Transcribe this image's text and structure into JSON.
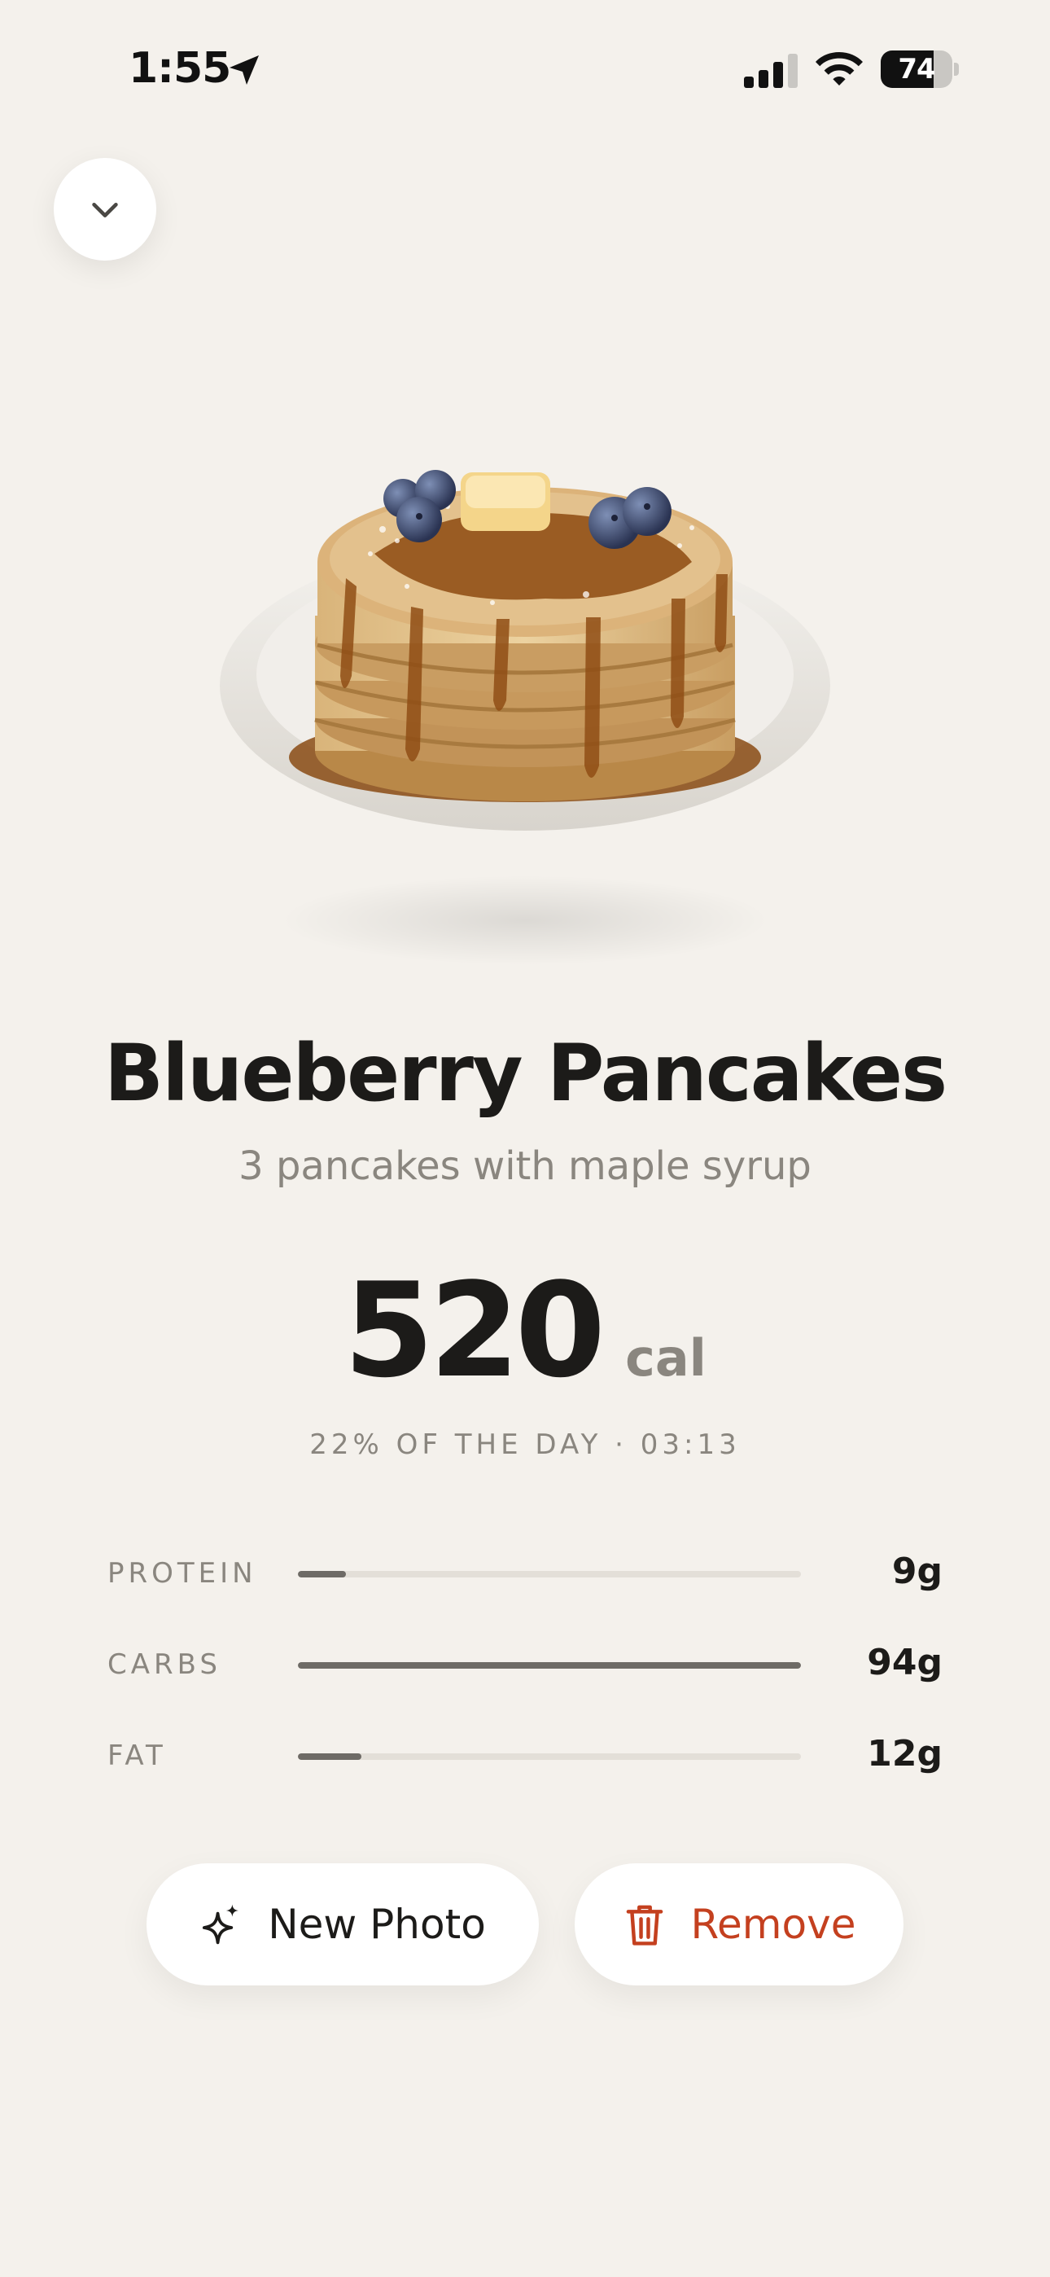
{
  "status_bar": {
    "time": "1:55",
    "battery_percent": 74,
    "battery_label": "74",
    "icons": [
      "location-arrow-icon",
      "cellular-signal-icon",
      "wifi-icon",
      "battery-icon"
    ]
  },
  "header": {
    "collapse_icon": "chevron-down-icon"
  },
  "food": {
    "image_subject": "stack of blueberry pancakes with butter and maple syrup on a plate",
    "title": "Blueberry Pancakes",
    "subtitle": "3 pancakes with maple syrup",
    "calories": "520",
    "calories_unit": "cal",
    "daily_meta": "22% OF THE DAY · 03:13"
  },
  "macros": [
    {
      "label": "PROTEIN",
      "value": "9g",
      "fill_fraction": 0.095
    },
    {
      "label": "CARBS",
      "value": "94g",
      "fill_fraction": 1.0
    },
    {
      "label": "FAT",
      "value": "12g",
      "fill_fraction": 0.127
    }
  ],
  "actions": {
    "new_photo_label": "New Photo",
    "new_photo_icon": "sparkle-icon",
    "remove_label": "Remove",
    "remove_icon": "trash-icon"
  },
  "colors": {
    "background": "#f4f1ec",
    "text_primary": "#1c1b19",
    "text_secondary": "#8a867f",
    "bar_fill": "#6e6b66",
    "bar_track": "#e3dfd8",
    "destructive": "#c4401f"
  }
}
